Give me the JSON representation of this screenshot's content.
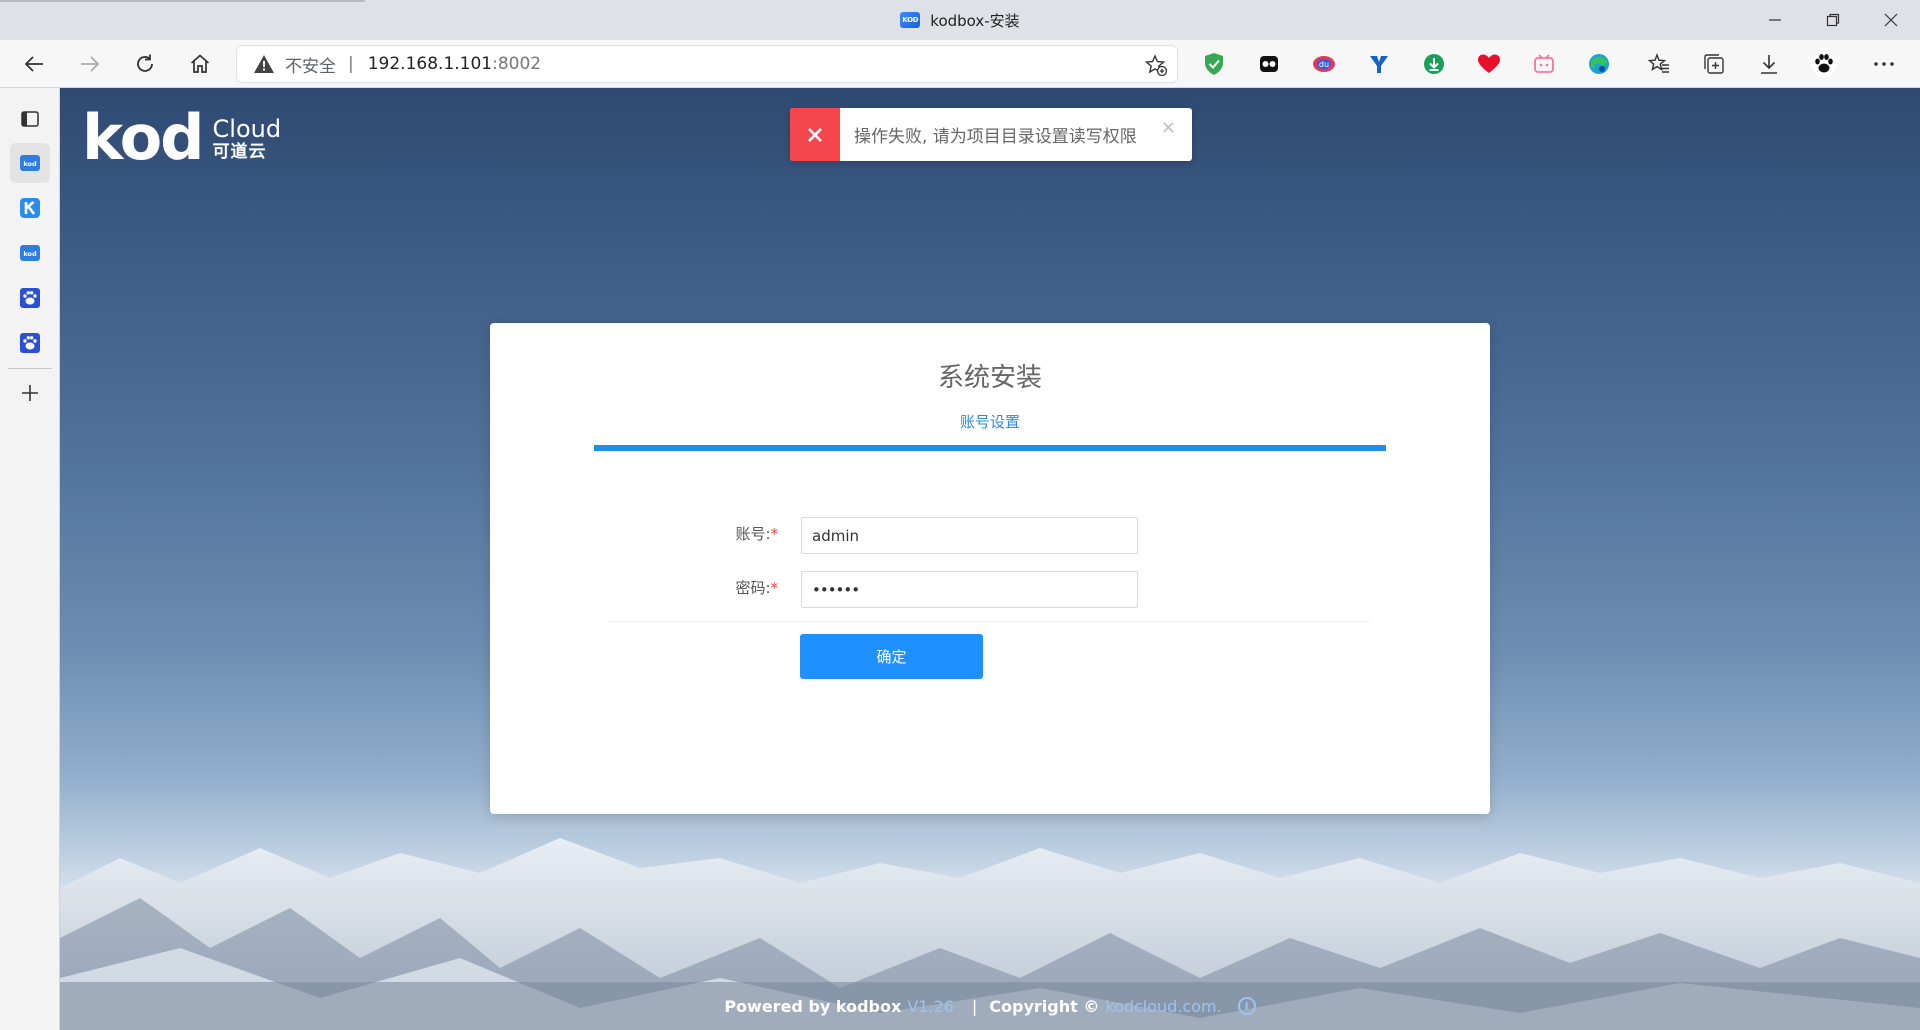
{
  "browser": {
    "window_title": "kodbox-安装",
    "favicon_text": "KOD",
    "address": {
      "security_label": "不安全",
      "host": "192.168.1.101",
      "port": ":8002"
    },
    "controls": {
      "minimize": "—",
      "restore": "❐",
      "close": "✕"
    },
    "extensions": [
      "shield-check",
      "mask",
      "du-app",
      "y-app",
      "download-green",
      "heart",
      "bilibili",
      "edge-color",
      "favorites",
      "collections",
      "downloads",
      "paw",
      "more"
    ]
  },
  "sidebar": {
    "items": [
      "tabs-panel",
      "kod-active",
      "k-app",
      "kod",
      "baidu",
      "baidu",
      "add"
    ]
  },
  "logo": {
    "main": "kod",
    "sub_en": "Cloud",
    "sub_cn": "可道云"
  },
  "toast": {
    "type": "error",
    "message": "操作失败, 请为项目目录设置读写权限",
    "close": "×"
  },
  "install": {
    "title": "系统安装",
    "step": "账号设置",
    "progress": 1.0,
    "fields": {
      "account_label": "账号:",
      "account_value": "admin",
      "password_label": "密码:",
      "password_value": "••••••",
      "required_mark": "*"
    },
    "submit_label": "确定"
  },
  "footer": {
    "powered": "Powered by kodbox",
    "version": "V1.26",
    "copyright": "Copyright ©",
    "domain": "kodcloud.com.",
    "info_glyph": "i"
  },
  "colors": {
    "primary": "#1e90ff",
    "error": "#f5464e",
    "link": "#2a8ae8"
  }
}
